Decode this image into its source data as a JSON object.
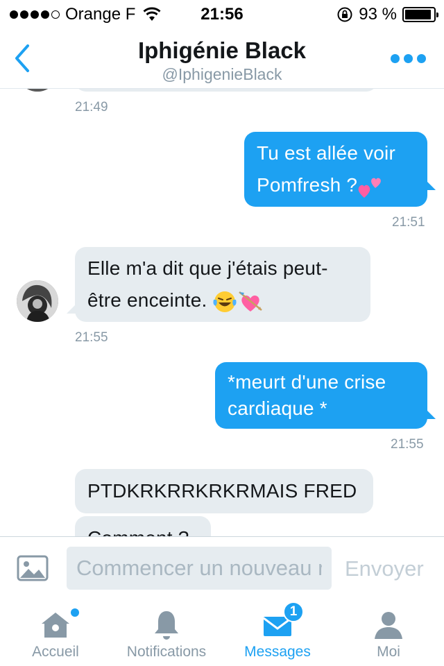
{
  "status_bar": {
    "carrier": "Orange F",
    "time": "21:56",
    "battery": "93 %",
    "battery_level": 0.93,
    "signal_bars": 4
  },
  "header": {
    "back_icon": "chevron-left-icon",
    "title": "Iphigénie Black",
    "handle": "@IphigenieBlack",
    "more_icon": "more-dots-icon"
  },
  "messages": [
    {
      "direction": "in",
      "time": "21:49"
    },
    {
      "direction": "out",
      "lines": [
        "Tu est allée voir",
        "Pomfresh ?"
      ],
      "emoji": [
        "two-hearts"
      ],
      "time": "21:51"
    },
    {
      "direction": "in",
      "lines": [
        "Elle m'a dit que j'étais peut-",
        "être enceinte."
      ],
      "emoji": [
        "tears-of-joy",
        "heart-with-arrow"
      ],
      "time": "21:55"
    },
    {
      "direction": "out",
      "lines": [
        "*meurt d'une crise",
        "cardiaque *"
      ],
      "time": "21:55"
    },
    {
      "direction": "in",
      "text": "PTDKRKRRKRKRMAIS FRED"
    },
    {
      "direction": "in",
      "text": "Comment ?"
    }
  ],
  "composer": {
    "photo_icon": "image-icon",
    "placeholder": "Commencer un nouveau message",
    "send_label": "Envoyer"
  },
  "tabs": [
    {
      "label": "Accueil",
      "icon": "home-icon",
      "has_dot": true
    },
    {
      "label": "Notifications",
      "icon": "bell-icon"
    },
    {
      "label": "Messages",
      "icon": "envelope-icon",
      "badge": "1",
      "active": true
    },
    {
      "label": "Moi",
      "icon": "person-icon"
    }
  ],
  "colors": {
    "accent": "#1da1f2",
    "incoming_bubble": "#e6ecf0",
    "muted_text": "#8899a6"
  }
}
